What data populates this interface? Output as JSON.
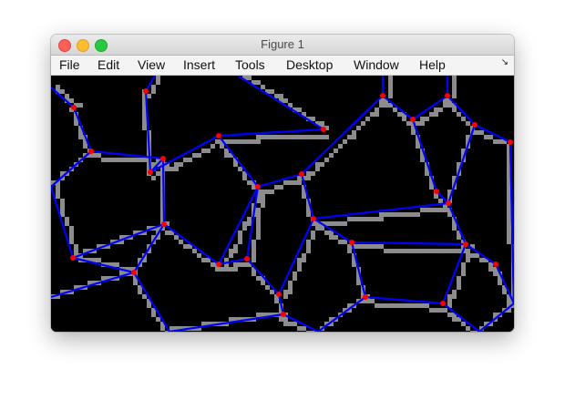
{
  "window": {
    "title": "Figure 1"
  },
  "menubar": {
    "items": [
      "File",
      "Edit",
      "View",
      "Insert",
      "Tools",
      "Desktop",
      "Window",
      "Help"
    ],
    "overflow_icon": "arrow-icon"
  },
  "colors": {
    "background": "#000000",
    "boundary_pixels": "#8c8c8c",
    "edges": "#0000ff",
    "vertices": "#ff0000"
  }
}
